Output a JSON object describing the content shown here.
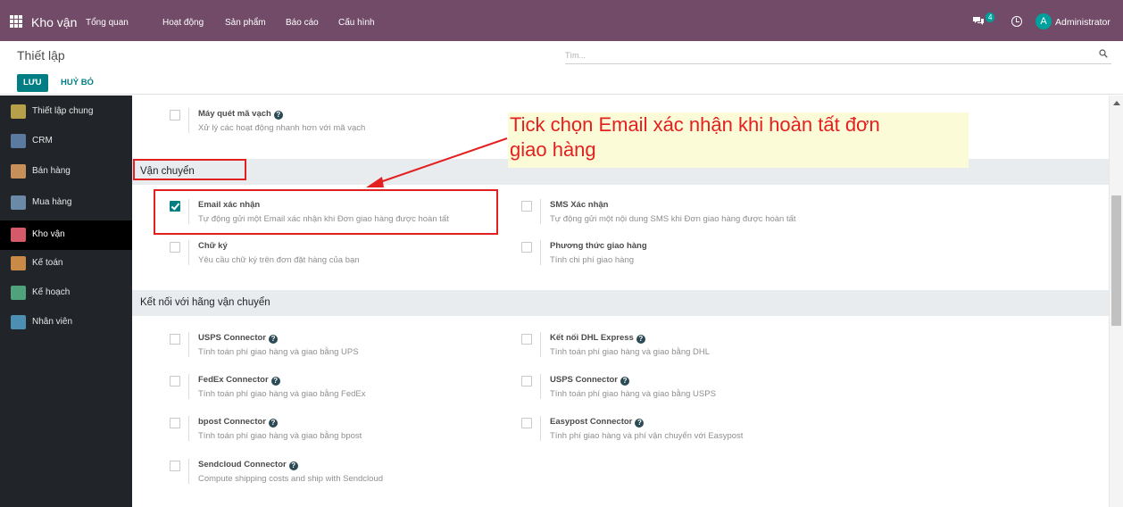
{
  "topbar": {
    "app_name": "Kho vận",
    "menu": [
      "Tổng quan",
      "Hoạt động",
      "Sản phẩm",
      "Báo cáo",
      "Cấu hình"
    ],
    "chat_count": "4",
    "avatar_letter": "A",
    "user": "Administrator",
    "bg_color": "#714b67"
  },
  "control": {
    "title": "Thiết lập",
    "search_placeholder": "Tìm...",
    "save": "LƯU",
    "discard": "HUỶ BỎ"
  },
  "sidebar": [
    {
      "label": "Thiết lập chung",
      "icon": "gear-icon",
      "color": "#b7a04a"
    },
    {
      "label": "CRM",
      "icon": "crm-icon",
      "color": "#5b7aa0"
    },
    {
      "label": "Bán hàng",
      "icon": "sales-chart-icon",
      "color": "#c7905a"
    },
    {
      "label": "Mua hàng",
      "icon": "purchase-icon",
      "color": "#6a8aa8"
    },
    {
      "label": "Kho vận",
      "icon": "inventory-icon",
      "color": "#d45a6a"
    },
    {
      "label": "Kế toán",
      "icon": "accounting-icon",
      "color": "#c98a48"
    },
    {
      "label": "Kế hoạch",
      "icon": "planning-icon",
      "color": "#4fa27c"
    },
    {
      "label": "Nhân viên",
      "icon": "employees-icon",
      "color": "#4d8fb3"
    }
  ],
  "barcode": {
    "title": "Máy quét mã vạch",
    "desc": "Xử lý các hoạt động nhanh hơn với mã vạch",
    "checked": false
  },
  "shipping": {
    "header": "Vận chuyển",
    "email": {
      "title": "Email xác nhận",
      "desc": "Tự động gửi một Email xác nhận khi Đơn giao hàng được hoàn tất",
      "checked": true
    },
    "sms": {
      "title": "SMS Xác nhận",
      "desc": "Tự động gửi một nội dung SMS khi Đơn giao hàng được hoàn tất",
      "checked": false
    },
    "signature": {
      "title": "Chữ ký",
      "desc": "Yêu cầu chữ ký trên đơn đặt hàng của bạn",
      "checked": false
    },
    "methods": {
      "title": "Phương thức giao hàng",
      "desc": "Tính chi phí giao hàng",
      "checked": false
    }
  },
  "carriers": {
    "header": "Kết nối với hãng vận chuyển",
    "ups": {
      "title": "USPS Connector",
      "desc": "Tính toán phí giao hàng và giao bằng UPS"
    },
    "dhl": {
      "title": "Kết nối DHL Express",
      "desc": "Tính toán phí giao hàng và giao bằng DHL"
    },
    "fedex": {
      "title": "FedEx Connector",
      "desc": "Tính toán phí giao hàng và giao bằng FedEx"
    },
    "usps": {
      "title": "USPS Connector",
      "desc": "Tính toán phí giao hàng và giao bằng USPS"
    },
    "bpost": {
      "title": "bpost Connector",
      "desc": "Tính toán phí giao hàng và giao bằng bpost"
    },
    "easypost": {
      "title": "Easypost Connector",
      "desc": "Tính phí giao hàng và phí vận chuyển với Easypost"
    },
    "sendcloud": {
      "title": "Sendcloud Connector",
      "desc": "Compute shipping costs and ship with Sendcloud"
    }
  },
  "annotation": {
    "line1": "Tick chọn Email xác nhận khi hoàn tất đơn",
    "line2": "giao hàng",
    "color": "#e32020"
  }
}
